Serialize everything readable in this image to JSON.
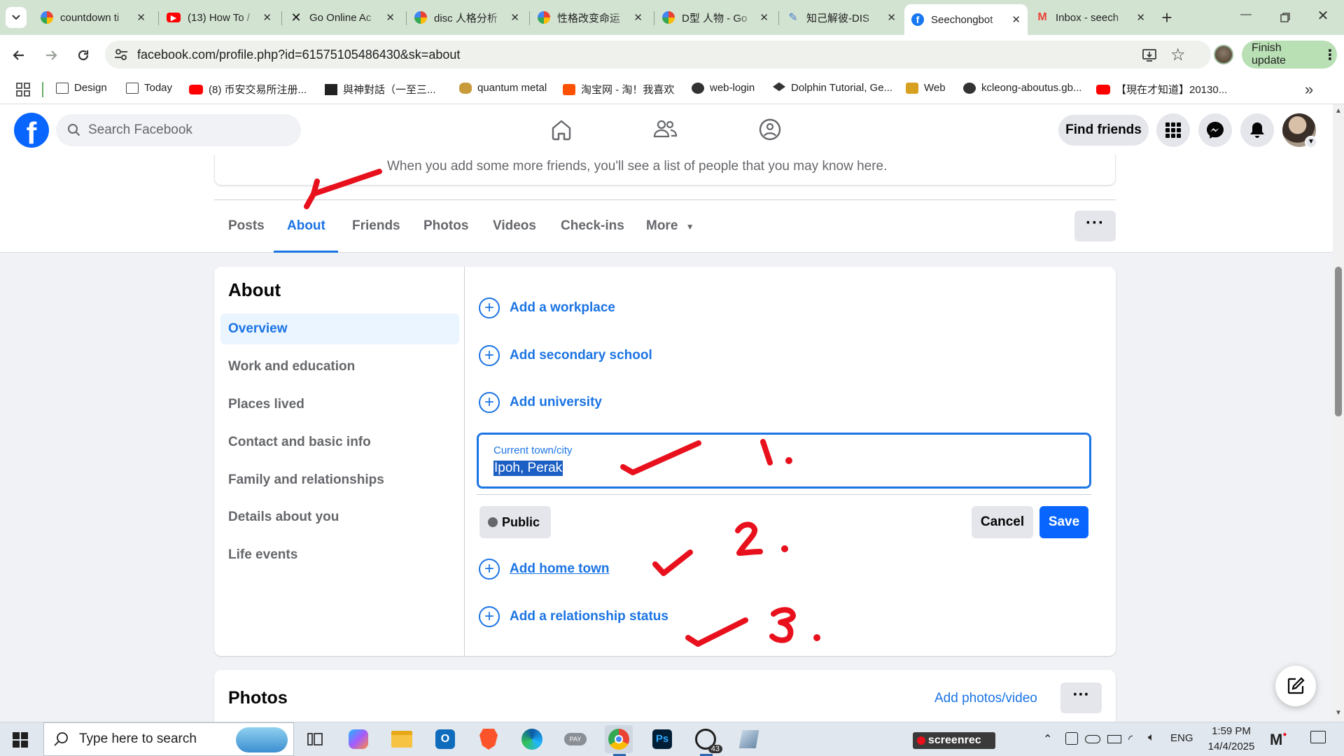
{
  "browser": {
    "tabs": [
      {
        "title": "countdown ti",
        "favicon": "google-icon"
      },
      {
        "title": "(13) How To /",
        "favicon": "youtube-icon"
      },
      {
        "title": "Go Online Ac",
        "favicon": "x-logo-icon"
      },
      {
        "title": "disc 人格分析",
        "favicon": "google-icon"
      },
      {
        "title": "性格改变命运",
        "favicon": "google-icon"
      },
      {
        "title": "D型 人物 - Go",
        "favicon": "google-icon"
      },
      {
        "title": "知己解彼-DIS",
        "favicon": "feather-icon"
      },
      {
        "title": "Seechongbot",
        "favicon": "facebook-icon",
        "active": true
      },
      {
        "title": "Inbox - seech",
        "favicon": "gmail-icon"
      }
    ],
    "url": "facebook.com/profile.php?id=61575105486430&sk=about",
    "finish_update": "Finish update",
    "bookmarks": [
      {
        "label": "Design",
        "icon": "folder-icon"
      },
      {
        "label": "Today",
        "icon": "folder-icon"
      },
      {
        "label": "(8) 币安交易所注册...",
        "icon": "youtube-icon"
      },
      {
        "label": "與神對話（一至三...",
        "icon": "book-icon"
      },
      {
        "label": "quantum metal",
        "icon": "gold-icon"
      },
      {
        "label": "淘宝网 - 淘！我喜欢",
        "icon": "taobao-icon"
      },
      {
        "label": "web-login",
        "icon": "globe-icon"
      },
      {
        "label": "Dolphin Tutorial, Ge...",
        "icon": "graduation-icon"
      },
      {
        "label": "Web",
        "icon": "web-icon"
      },
      {
        "label": "kcleong-aboutus.gb...",
        "icon": "globe-icon"
      },
      {
        "label": "【現在才知道】20130...",
        "icon": "youtube-icon"
      }
    ]
  },
  "facebook": {
    "search_placeholder": "Search Facebook",
    "find_friends": "Find friends",
    "friends_hint": "When you add some more friends, you'll see a list of people that you may know here.",
    "profile_tabs": [
      "Posts",
      "About",
      "Friends",
      "Photos",
      "Videos",
      "Check-ins",
      "More"
    ],
    "active_tab": "About",
    "about": {
      "title": "About",
      "side": [
        "Overview",
        "Work and education",
        "Places lived",
        "Contact and basic info",
        "Family and relationships",
        "Details about you",
        "Life events"
      ],
      "add_workplace": "Add a workplace",
      "add_secondary": "Add secondary school",
      "add_university": "Add university",
      "town_label": "Current town/city",
      "town_value": "Ipoh, Perak",
      "privacy": "Public",
      "cancel": "Cancel",
      "save": "Save",
      "add_hometown": "Add home town",
      "add_relationship": "Add a relationship status"
    },
    "photos": {
      "title": "Photos",
      "add": "Add photos/video"
    },
    "annotations": [
      "1.",
      "2.",
      "3."
    ]
  },
  "taskbar": {
    "search_placeholder": "Type here to search",
    "whatsapp_badge": "43",
    "screenrec": "screenrec",
    "lang": "ENG",
    "time": "1:59 PM",
    "date": "14/4/2025"
  },
  "colors": {
    "fb_blue": "#1877f2",
    "link_blue": "#1b74e4",
    "annot_red": "#e8101c",
    "chrome_frame": "#d3e3d2"
  }
}
